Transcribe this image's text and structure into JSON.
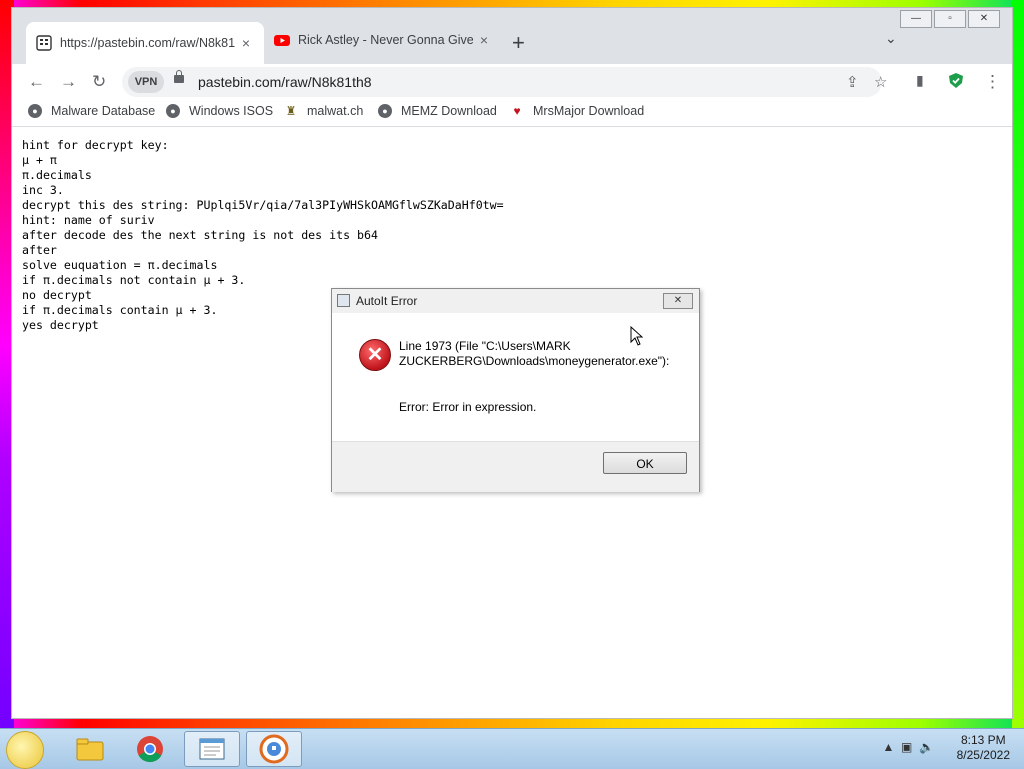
{
  "browser": {
    "tabs": [
      {
        "title": "https://pastebin.com/raw/N8k81",
        "close": "×",
        "active": true
      },
      {
        "title": "Rick Astley - Never Gonna Give Y",
        "close": "×",
        "active": false
      }
    ],
    "new_tab": "+",
    "window_controls": {
      "minimize": "—",
      "maximize": "▫",
      "close": "✕"
    },
    "vpn_label": "VPN",
    "url": "pastebin.com/raw/N8k81th8",
    "bookmarks": [
      "Malware Database",
      "Windows ISOS",
      "malwat.ch",
      "MEMZ Download",
      "MrsMajor Download"
    ]
  },
  "page_text": [
    "hint for decrypt key:",
    "μ + π",
    "π.decimals",
    "inc 3.",
    "decrypt this des string: PUplqi5Vr/qia/7al3PIyWHSkOAMGflwSZKaDaHf0tw=",
    "hint: name of suriv",
    "after decode des the next string is not des its b64",
    "after",
    "solve euquation = π.decimals",
    "if π.decimals not contain μ + 3.",
    "no decrypt",
    "if π.decimals contain μ + 3.",
    "yes decrypt"
  ],
  "dialog": {
    "title": "AutoIt Error",
    "message": "Line 1973  (File \"C:\\Users\\MARK ZUCKERBERG\\Downloads\\moneygenerator.exe\"):",
    "error": "Error: Error in expression.",
    "ok_label": "OK",
    "close": "✕"
  },
  "taskbar": {
    "time": "8:13 PM",
    "date": "8/25/2022"
  },
  "colors": {
    "error_red": "#c0141b",
    "tab_strip": "#dee1e6",
    "taskbar": "#b7d3ed"
  }
}
